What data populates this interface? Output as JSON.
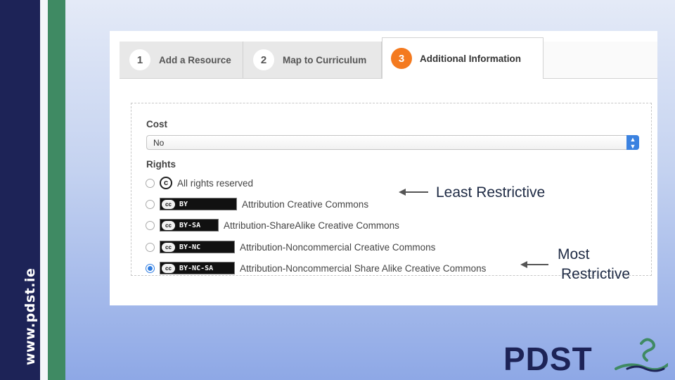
{
  "slide": {
    "site_url": "www.pdst.ie",
    "logo_text": "PDST",
    "colors": {
      "navy": "#1d2357",
      "green": "#3f8a63",
      "orange": "#f47a1f",
      "radio_blue": "#2f7de1"
    }
  },
  "wizard": {
    "tabs": [
      {
        "number": "1",
        "label": "Add a Resource",
        "active": false
      },
      {
        "number": "2",
        "label": "Map to Curriculum",
        "active": false
      },
      {
        "number": "3",
        "label": "Additional Information",
        "active": true
      }
    ]
  },
  "form": {
    "cost": {
      "label": "Cost",
      "value": "No"
    },
    "rights": {
      "label": "Rights",
      "options": [
        {
          "icon": "copyright-icon",
          "label": "All rights reserved",
          "checked": false
        },
        {
          "icon": "cc-by-badge",
          "badge": "BY",
          "label": "Attribution Creative Commons",
          "checked": false
        },
        {
          "icon": "cc-by-sa-badge",
          "badge": "BY-SA",
          "label": "Attribution-ShareAlike Creative Commons",
          "checked": false
        },
        {
          "icon": "cc-by-nc-badge",
          "badge": "BY-NC",
          "label": "Attribution-Noncommercial Creative Commons",
          "checked": false
        },
        {
          "icon": "cc-by-nc-sa-badge",
          "badge": "BY-NC-SA",
          "label": "Attribution-Noncommercial Share Alike Creative Commons",
          "checked": true
        }
      ]
    }
  },
  "annotations": {
    "least": "Least Restrictive",
    "most_line1": "Most",
    "most_line2": "Restrictive"
  }
}
